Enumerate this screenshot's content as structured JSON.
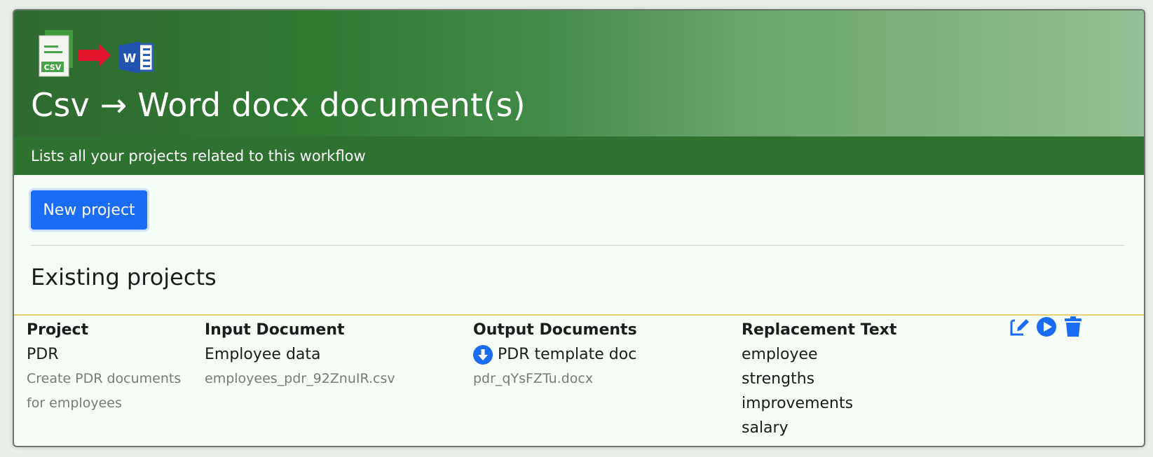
{
  "header": {
    "title": "Csv → Word docx document(s)",
    "subtitle": "Lists all your projects related to this workflow",
    "logo_text": "CSV"
  },
  "actions": {
    "new_project_label": "New project"
  },
  "section": {
    "title": "Existing projects"
  },
  "table": {
    "headers": {
      "project": "Project",
      "input": "Input Document",
      "output": "Output Documents",
      "replacement": "Replacement Text"
    },
    "rows": [
      {
        "project_name": "PDR",
        "project_desc_line1": "Create PDR documents",
        "project_desc_line2": "for employees",
        "input_name": "Employee data",
        "input_file": "employees_pdr_92ZnuIR.csv",
        "output_name": "PDR template doc",
        "output_file": "pdr_qYsFZTu.docx",
        "replacement_terms": [
          "employee",
          "strengths",
          "improvements",
          "salary"
        ]
      }
    ]
  },
  "icons": {
    "download": "download-circle-icon",
    "edit": "edit-icon",
    "run": "play-circle-icon",
    "delete": "trash-icon"
  },
  "colors": {
    "primary": "#1a6cf5",
    "header_bar": "#2d732f",
    "table_border": "#e9cf72"
  }
}
